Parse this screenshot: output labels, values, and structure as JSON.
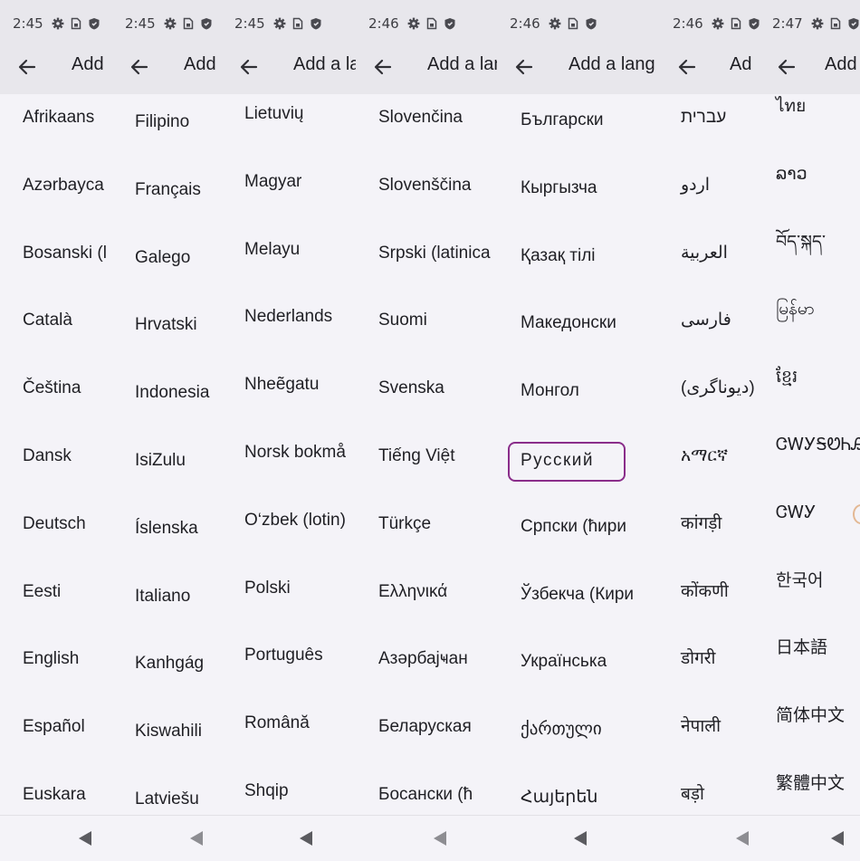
{
  "status_times": [
    "2:45",
    "2:45",
    "2:45",
    "2:46",
    "2:46",
    "2:46",
    "2:47"
  ],
  "titles": [
    "Add",
    "Add",
    "Add a la",
    "Add a lan",
    "Add a lang",
    "Ad",
    "Add"
  ],
  "columns": [
    [
      "Afrikaans",
      "Azərbayca",
      "Bosanski (l",
      "Català",
      "Čeština",
      "Dansk",
      "Deutsch",
      "Eesti",
      "English",
      "Español",
      "Euskara"
    ],
    [
      "Filipino",
      "Français",
      "Galego",
      "Hrvatski",
      "Indonesia",
      "IsiZulu",
      "Íslenska",
      "Italiano",
      "Kanhgág",
      "Kiswahili",
      "Latviešu"
    ],
    [
      "Lietuvių",
      "Magyar",
      "Melayu",
      "Nederlands",
      "Nheẽgatu",
      "Norsk bokmå",
      "O‘zbek (lotin)",
      "Polski",
      "Português",
      "Română",
      "Shqip"
    ],
    [
      "Slovenčina",
      "Slovenščina",
      "Srpski (latinica",
      "Suomi",
      "Svenska",
      "Tiếng Việt",
      "Türkçe",
      "Ελληνικά",
      "Азәрбајҹан",
      "Беларуская",
      "Босански (ћ"
    ],
    [
      "Български",
      "Кыргызча",
      "Қазақ тілі",
      "Македонски",
      "Монгол",
      "Русский",
      "Српски (ћири",
      "Ўзбекча (Кири",
      "Українська",
      "ქართული",
      "Հայերեն"
    ],
    [
      "עברית",
      "اردو",
      "العربية",
      "فارسی",
      "(دیوناگری)",
      "አማርኛ",
      "कांगड़ी",
      "कोंकणी",
      "डोगरी",
      "नेपाली",
      "बड़ो"
    ],
    [
      "ไทย",
      "ລາວ",
      "བོད་སྐད་",
      "မြန်မာ",
      "ខ្មែរ",
      "ᏣᎳᎩᎦᏬᏂᎯᏍᏗ",
      "ᏣᎳᎩ",
      "한국어",
      "日本語",
      "简体中文",
      "繁體中文"
    ]
  ],
  "selected_item": "Русский",
  "colors": {
    "selection_border": "#8a2d8a",
    "top_bar": "#e8e7ec",
    "background": "#f4f3f8"
  },
  "icons": [
    "back-arrow-icon",
    "settings-gear-icon",
    "sim-card-icon",
    "shield-icon",
    "nav-back-icon"
  ]
}
